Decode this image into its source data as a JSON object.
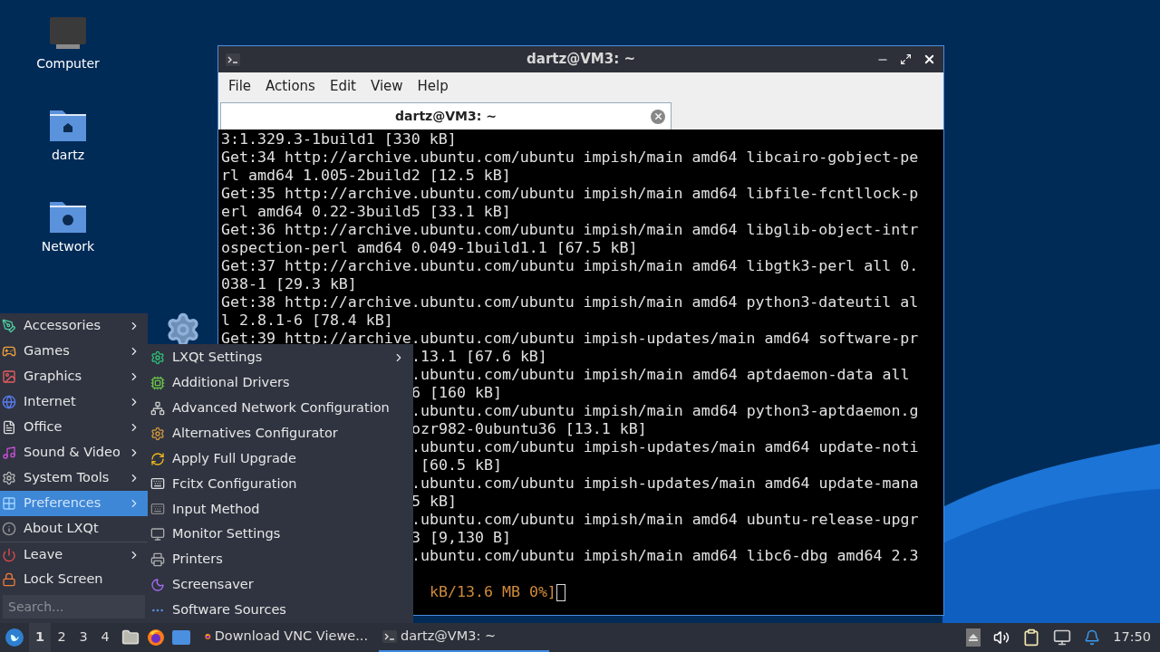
{
  "desktop_icons": [
    {
      "kind": "computer",
      "label": "Computer"
    },
    {
      "kind": "home",
      "label": "dartz"
    },
    {
      "kind": "network",
      "label": "Network"
    },
    {
      "kind": "settings"
    }
  ],
  "window": {
    "title": "dartz@VM3: ~",
    "menu": [
      "File",
      "Actions",
      "Edit",
      "View",
      "Help"
    ],
    "tabs": [
      {
        "label": "dartz@VM3: ~",
        "selected": true
      }
    ],
    "lines": [
      {
        "kind": "full",
        "text": "3:1.329.3-1build1 [330 kB]"
      },
      {
        "kind": "full",
        "text": "Get:34 http://archive.ubuntu.com/ubuntu impish/main amd64 libcairo-gobject-pe"
      },
      {
        "kind": "full",
        "text": "rl amd64 1.005-2build2 [12.5 kB]"
      },
      {
        "kind": "full",
        "text": "Get:35 http://archive.ubuntu.com/ubuntu impish/main amd64 libfile-fcntllock-p"
      },
      {
        "kind": "full",
        "text": "erl amd64 0.22-3build5 [33.1 kB]"
      },
      {
        "kind": "full",
        "text": "Get:36 http://archive.ubuntu.com/ubuntu impish/main amd64 libglib-object-intr"
      },
      {
        "kind": "full",
        "text": "ospection-perl amd64 0.049-1build1.1 [67.5 kB]"
      },
      {
        "kind": "full",
        "text": "Get:37 http://archive.ubuntu.com/ubuntu impish/main amd64 libgtk3-perl all 0."
      },
      {
        "kind": "full",
        "text": "038-1 [29.3 kB]"
      },
      {
        "kind": "full",
        "text": "Get:38 http://archive.ubuntu.com/ubuntu impish/main amd64 python3-dateutil al"
      },
      {
        "kind": "full",
        "text": "l 2.8.1-6 [78.4 kB]"
      },
      {
        "kind": "full",
        "text": "Get:39 http://archive.ubuntu.com/ubuntu impish-updates/main amd64 software-pr"
      },
      {
        "kind": "partial",
        "text": ".13.1 [67.6 kB]"
      },
      {
        "kind": "partial",
        "text": ".ubuntu.com/ubuntu impish/main amd64 aptdaemon-data all"
      },
      {
        "kind": "partial",
        "text": "6 [160 kB]"
      },
      {
        "kind": "partial",
        "text": ".ubuntu.com/ubuntu impish/main amd64 python3-aptdaemon.g"
      },
      {
        "kind": "partial",
        "text": "ozr982-0ubuntu36 [13.1 kB]"
      },
      {
        "kind": "partial",
        "text": ".ubuntu.com/ubuntu impish-updates/main amd64 update-noti"
      },
      {
        "kind": "partial",
        "text": " [60.5 kB]"
      },
      {
        "kind": "partial",
        "text": ".ubuntu.com/ubuntu impish-updates/main amd64 update-mana"
      },
      {
        "kind": "partial",
        "text": "5 kB]"
      },
      {
        "kind": "partial",
        "text": ".ubuntu.com/ubuntu impish/main amd64 ubuntu-release-upgr"
      },
      {
        "kind": "partial",
        "text": "3 [9,130 B]"
      },
      {
        "kind": "partial",
        "text": ".ubuntu.com/ubuntu impish/main amd64 libc6-dbg amd64 2.3"
      },
      {
        "kind": "progress",
        "text": "kB/13.6 MB 0%]"
      }
    ]
  },
  "app_menu": {
    "items": [
      {
        "label": "Accessories",
        "submenu": true,
        "selected": false
      },
      {
        "label": "Games",
        "submenu": true,
        "selected": false
      },
      {
        "label": "Graphics",
        "submenu": true,
        "selected": false
      },
      {
        "label": "Internet",
        "submenu": true,
        "selected": false
      },
      {
        "label": "Office",
        "submenu": true,
        "selected": false
      },
      {
        "label": "Sound & Video",
        "submenu": true,
        "selected": false
      },
      {
        "label": "System Tools",
        "submenu": true,
        "selected": false
      },
      {
        "label": "Preferences",
        "submenu": true,
        "selected": true
      },
      {
        "label": "About LXQt",
        "submenu": false,
        "selected": false
      },
      {
        "label": "Leave",
        "submenu": true,
        "selected": false
      },
      {
        "label": "Lock Screen",
        "submenu": false,
        "selected": false
      }
    ],
    "search": {
      "placeholder": "Search..."
    }
  },
  "submenu": {
    "items": [
      {
        "label": "LXQt Settings",
        "submenu": true
      },
      {
        "label": "Additional Drivers",
        "submenu": false
      },
      {
        "label": "Advanced Network Configuration",
        "submenu": false
      },
      {
        "label": "Alternatives Configurator",
        "submenu": false
      },
      {
        "label": "Apply Full Upgrade",
        "submenu": false
      },
      {
        "label": "Fcitx Configuration",
        "submenu": false
      },
      {
        "label": "Input Method",
        "submenu": false
      },
      {
        "label": "Monitor Settings",
        "submenu": false
      },
      {
        "label": "Printers",
        "submenu": false
      },
      {
        "label": "Screensaver",
        "submenu": false
      },
      {
        "label": "Software Sources",
        "submenu": false
      }
    ]
  },
  "taskbar": {
    "desktops": [
      {
        "label": "1",
        "selected": true
      },
      {
        "label": "2",
        "selected": false
      },
      {
        "label": "3",
        "selected": false
      },
      {
        "label": "4",
        "selected": false
      }
    ],
    "tasks": [
      {
        "kind": "browser",
        "label": "Download VNC Viewe...",
        "selected": false
      },
      {
        "kind": "terminal",
        "label": "dartz@VM3: ~",
        "selected": true
      }
    ],
    "clock": "17:50"
  }
}
